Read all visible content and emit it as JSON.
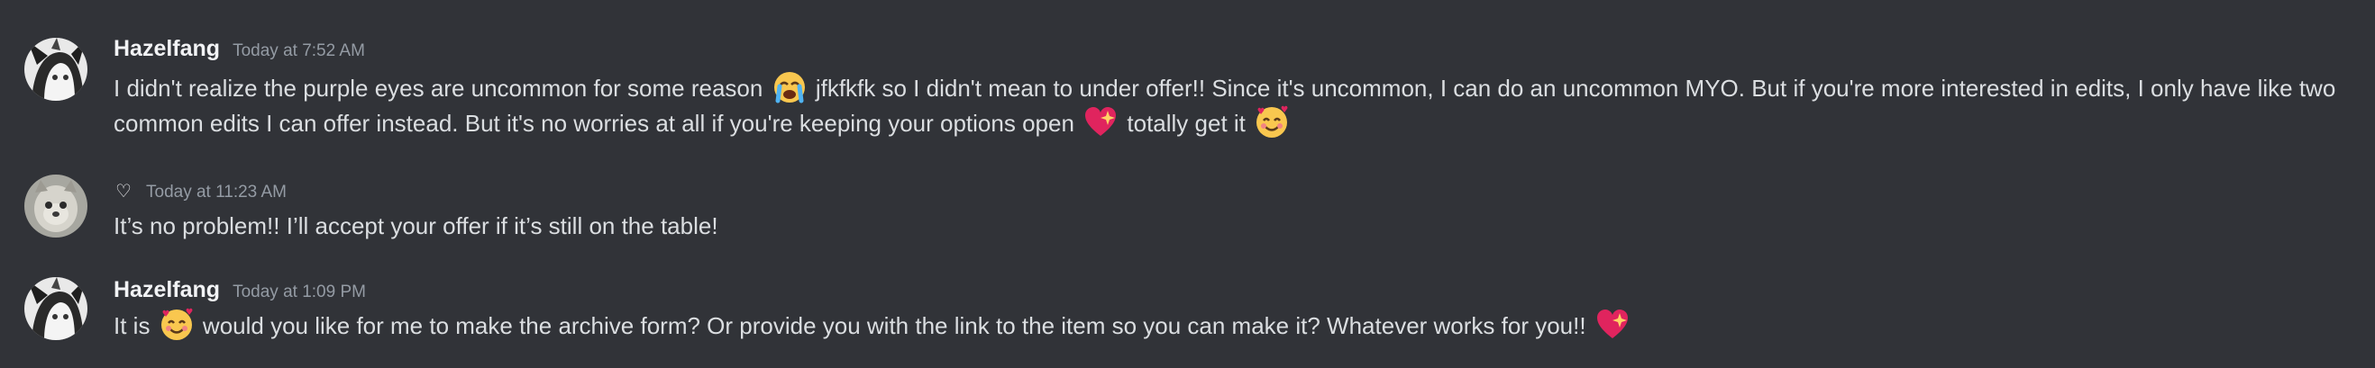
{
  "messages": [
    {
      "author": "Hazelfang",
      "timestamp": "Today at 7:52 AM",
      "text_1": "I didn't realize the purple eyes are uncommon for some reason",
      "emoji_1": "loudly-crying-face",
      "text_2": "jfkfkfk so I didn't mean to under offer!! Since it's uncommon, I can do an uncommon MYO. But if you're more interested in edits, I only have like two common edits I can offer instead. But it's no worries at all if you're keeping your options open",
      "emoji_2": "sparkling-heart",
      "text_3": "totally get it",
      "emoji_3": "smiling-face-with-hearts"
    },
    {
      "author_icon": "♡",
      "timestamp": "Today at 11:23 AM",
      "text_1": "It’s no problem!! I’ll accept your offer if it’s still on the table!"
    },
    {
      "author": "Hazelfang",
      "timestamp": "Today at 1:09 PM",
      "text_1": "It is",
      "emoji_1": "smiling-face-with-hearts",
      "text_2": "would you like for me to make the archive form? Or provide you with the link to the item so you can make it? Whatever works for you!!",
      "emoji_2": "sparkling-heart"
    }
  ],
  "colors": {
    "background": "#313338",
    "text": "#dbdee1",
    "username": "#f2f3f5",
    "timestamp": "#949ba4"
  }
}
